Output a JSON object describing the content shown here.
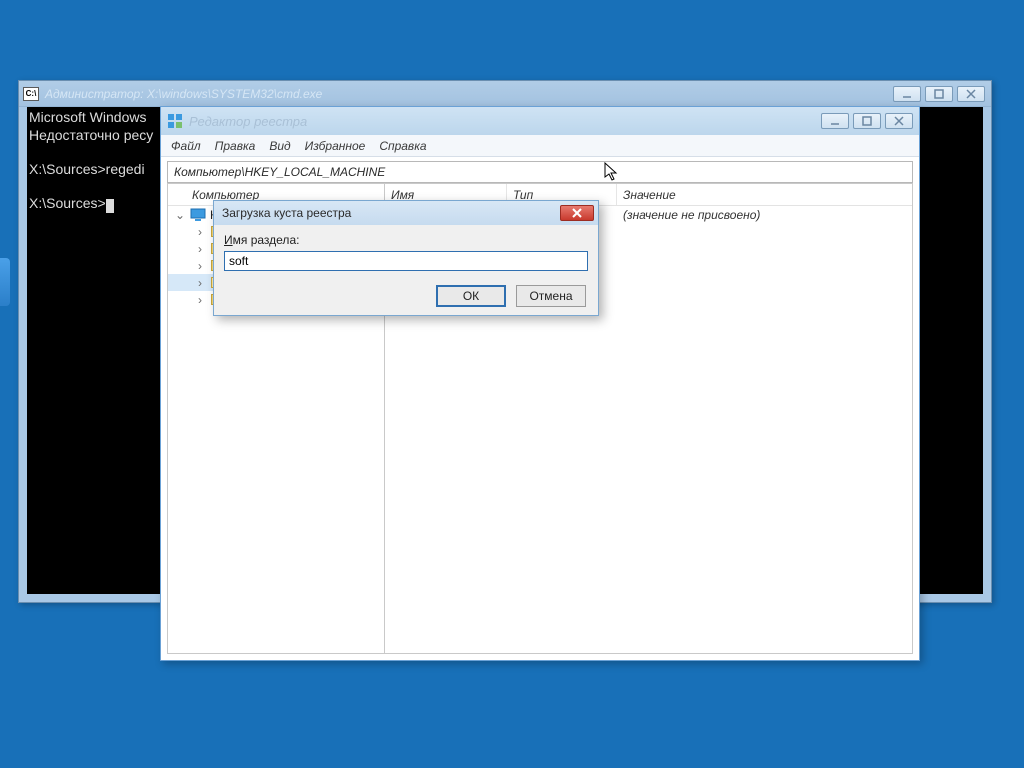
{
  "cmd": {
    "title": "Администратор: X:\\windows\\SYSTEM32\\cmd.exe",
    "icon_label": "C:\\",
    "lines": {
      "l1": "Microsoft Windows",
      "l2": "Недостаточно ресу",
      "l3": "",
      "l4": "X:\\Sources>regedi",
      "l5": "",
      "l6": "X:\\Sources>"
    }
  },
  "regedit": {
    "title": "Редактор реестра",
    "menu": {
      "file": "Файл",
      "edit": "Правка",
      "view": "Вид",
      "favorites": "Избранное",
      "help": "Справка"
    },
    "address": "Компьютер\\HKEY_LOCAL_MACHINE",
    "tree": {
      "root": "Компьютер",
      "headers": {
        "root_col": "Компьютер"
      }
    },
    "list": {
      "headers": {
        "name": "Имя",
        "type": "Тип",
        "value": "Значение"
      },
      "rows": [
        {
          "name": "",
          "type": "",
          "value": "(значение не присвоено)"
        }
      ]
    }
  },
  "dialog": {
    "title": "Загрузка куста реестра",
    "label_prefix": "И",
    "label_rest": "мя раздела:",
    "input_value": "soft",
    "ok": "ОК",
    "cancel": "Отмена"
  }
}
